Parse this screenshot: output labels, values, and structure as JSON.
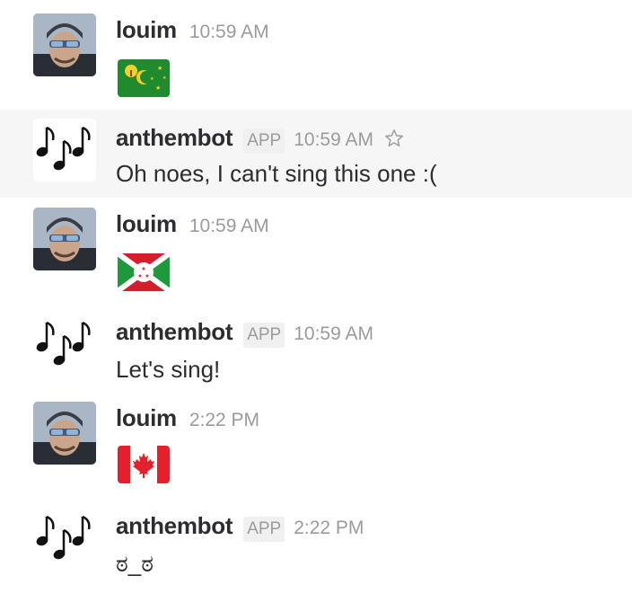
{
  "messages": [
    {
      "author": "louim",
      "time": "10:59 AM",
      "flag": "Cocos (Keeling) Islands",
      "flag_icon": "cocos-islands-flag-icon"
    },
    {
      "author": "anthembot",
      "badge": "APP",
      "time": "10:59 AM",
      "text": "Oh noes, I can't sing this one :("
    },
    {
      "author": "louim",
      "time": "10:59 AM",
      "flag": "Burundi",
      "flag_icon": "burundi-flag-icon"
    },
    {
      "author": "anthembot",
      "badge": "APP",
      "time": "10:59 AM",
      "text": "Let's sing!"
    },
    {
      "author": "louim",
      "time": "2:22 PM",
      "flag": "Canada",
      "flag_icon": "canada-flag-icon"
    },
    {
      "author": "anthembot",
      "badge": "APP",
      "time": "2:22 PM",
      "text": "ಠ_ಠ"
    }
  ],
  "colors": {
    "name": "#2c2d30",
    "meta": "#9b9b9e",
    "highlight": "#f6f6f6",
    "badge_bg": "#f0f0f0"
  }
}
